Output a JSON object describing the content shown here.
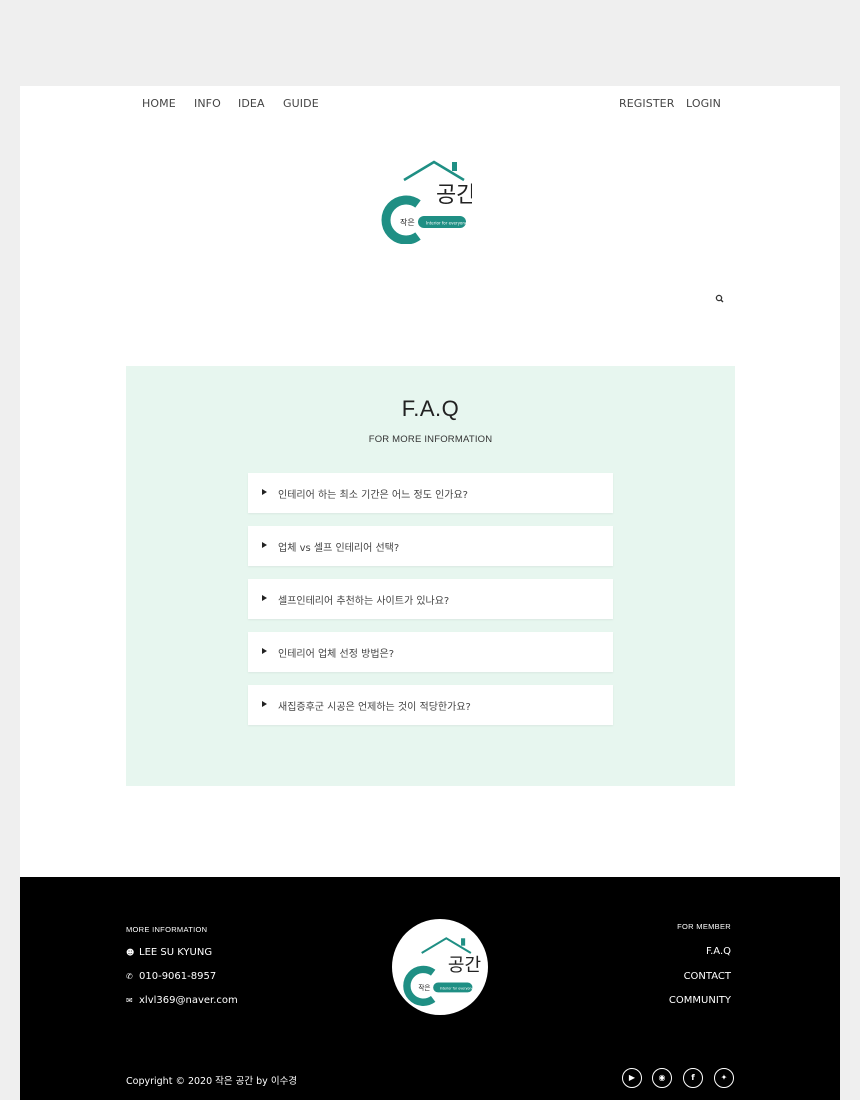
{
  "nav": {
    "left": [
      "HOME",
      "INFO",
      "IDEA",
      "GUIDE"
    ],
    "right": [
      "REGISTER",
      "LOGIN"
    ]
  },
  "logo": {
    "main_text": "공간",
    "small_text": "작은",
    "tagline": "Interior for everyone",
    "color": "#1f8f84"
  },
  "faq": {
    "title": "F.A.Q",
    "subtitle": "FOR MORE INFORMATION",
    "items": [
      "인테리어 하는 최소 기간은 어느 정도 인가요?",
      "업체 vs 셀프 인테리어 선택?",
      "셀프인테리어 추천하는 사이트가 있나요?",
      "인테리어 업체 선정 방법은?",
      "새집증후군 시공은 언제하는 것이 적당한가요?"
    ],
    "background": "#e7f6ef"
  },
  "footer": {
    "info_heading": "MORE INFORMATION",
    "name": "LEE SU KYUNG",
    "phone": "010-9061-8957",
    "email": "xlvl369@naver.com",
    "member_heading": "FOR MEMBER",
    "links": [
      "F.A.Q",
      "CONTACT",
      "COMMUNITY"
    ],
    "copyright": "Copyright © 2020 작은 공간 by 이수경",
    "social": [
      "youtube-icon",
      "instagram-icon",
      "facebook-icon",
      "twitter-icon"
    ]
  }
}
